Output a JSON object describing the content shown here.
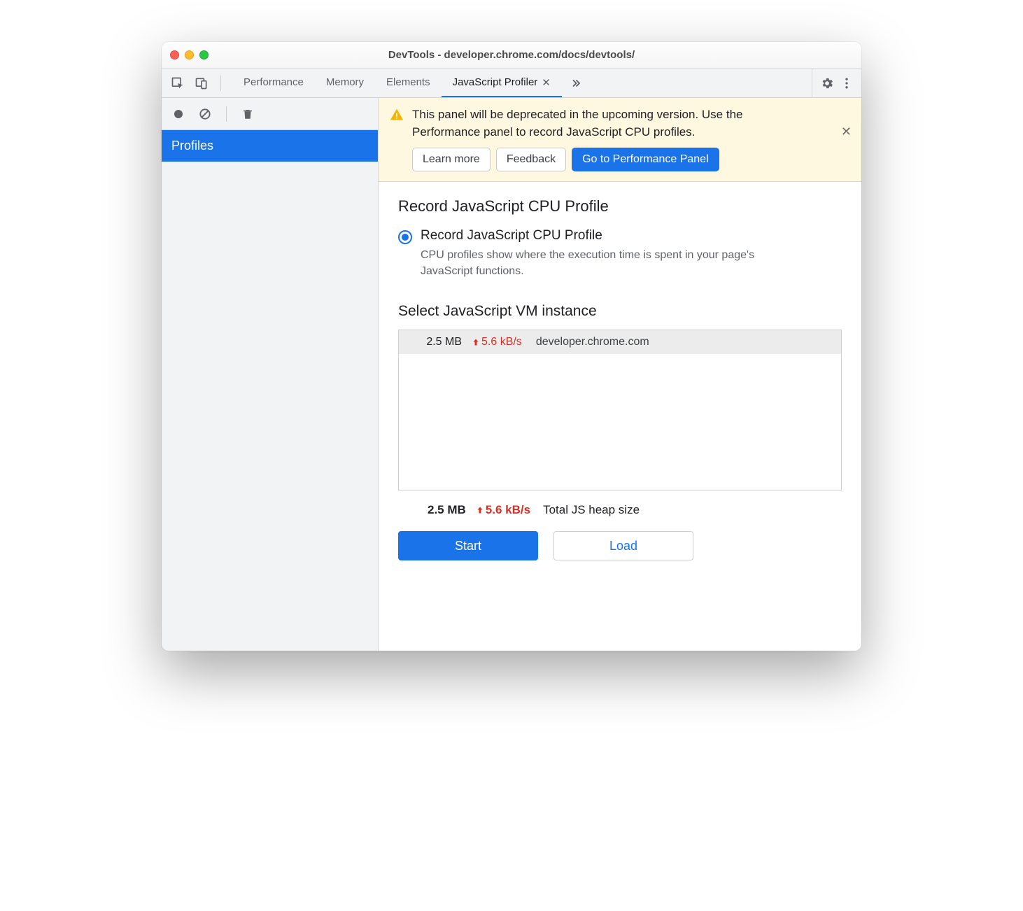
{
  "window_title": "DevTools - developer.chrome.com/docs/devtools/",
  "tabs": {
    "items": [
      "Performance",
      "Memory",
      "Elements",
      "JavaScript Profiler"
    ],
    "active_index": 3
  },
  "sidebar": {
    "items": [
      {
        "label": "Profiles"
      }
    ]
  },
  "banner": {
    "message": "This panel will be deprecated in the upcoming version. Use the Performance panel to record JavaScript CPU profiles.",
    "learn_more": "Learn more",
    "feedback": "Feedback",
    "goto": "Go to Performance Panel"
  },
  "content": {
    "heading": "Record JavaScript CPU Profile",
    "radio_label": "Record JavaScript CPU Profile",
    "radio_desc": "CPU profiles show where the execution time is spent in your page's JavaScript functions.",
    "vm_heading": "Select JavaScript VM instance",
    "vm_instances": [
      {
        "size": "2.5 MB",
        "rate": "5.6 kB/s",
        "host": "developer.chrome.com"
      }
    ],
    "totals": {
      "size": "2.5 MB",
      "rate": "5.6 kB/s",
      "label": "Total JS heap size"
    },
    "start_label": "Start",
    "load_label": "Load"
  }
}
